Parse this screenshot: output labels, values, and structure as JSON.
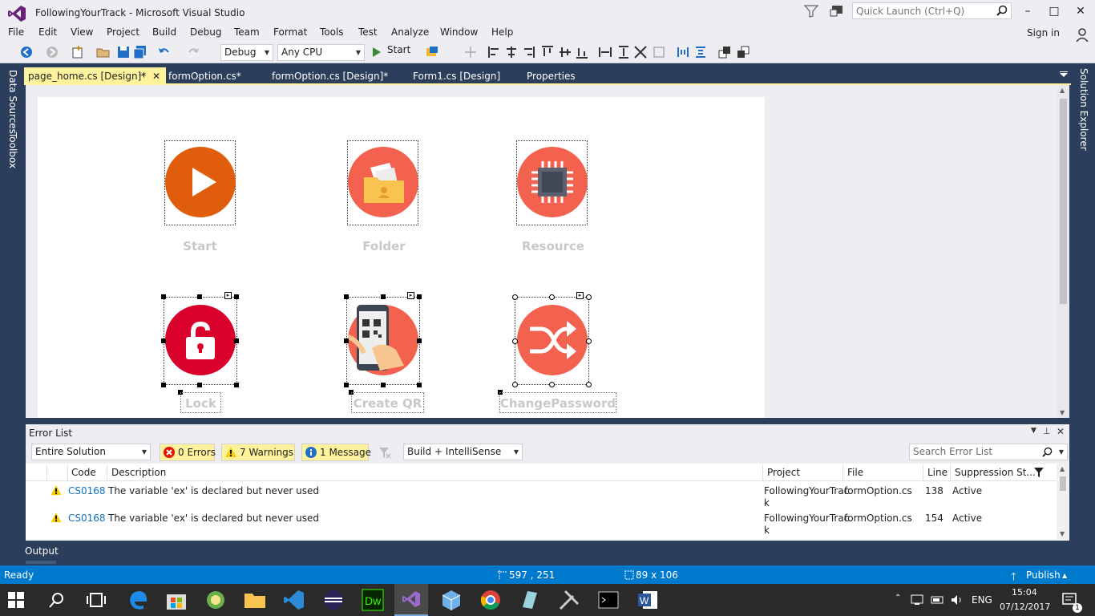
{
  "window": {
    "title": "FollowingYourTrack - Microsoft Visual Studio",
    "quick_launch_placeholder": "Quick Launch (Ctrl+Q)",
    "minimize": "–",
    "maximize": "□",
    "close": "✕"
  },
  "menu": {
    "items": [
      "File",
      "Edit",
      "View",
      "Project",
      "Build",
      "Debug",
      "Team",
      "Format",
      "Tools",
      "Test",
      "Analyze",
      "Window",
      "Help"
    ],
    "sign_in": "Sign in"
  },
  "toolbar": {
    "config": "Debug",
    "platform": "Any CPU",
    "start_label": "Start"
  },
  "side_tabs": {
    "left": [
      "Data Sources",
      "Toolbox"
    ],
    "right": "Solution Explorer"
  },
  "doc_tabs": [
    {
      "label": "page_home.cs [Design]*",
      "active": true
    },
    {
      "label": "formOption.cs*",
      "active": false
    },
    {
      "label": "formOption.cs [Design]*",
      "active": false
    },
    {
      "label": "Form1.cs [Design]",
      "active": false
    },
    {
      "label": "Properties",
      "active": false
    }
  ],
  "designer": {
    "buttons": [
      {
        "label": "Start",
        "color": "#e05e0b"
      },
      {
        "label": "Folder",
        "color": "#f2624f"
      },
      {
        "label": "Resource",
        "color": "#f2624f"
      },
      {
        "label": "Lock",
        "color": "#d9002c"
      },
      {
        "label": "Create QR",
        "color": "#f2624f"
      },
      {
        "label": "ChangePassword",
        "color": "#f2624f"
      }
    ]
  },
  "error_list": {
    "title": "Error List",
    "scope": "Entire Solution",
    "errors": "0 Errors",
    "warnings": "7 Warnings",
    "messages": "1 Message",
    "source": "Build + IntelliSense",
    "search_placeholder": "Search Error List",
    "columns": [
      "Code",
      "Description",
      "Project",
      "File",
      "Line",
      "Suppression St..."
    ],
    "rows": [
      {
        "code": "CS0168",
        "description": "The variable 'ex' is declared but never used",
        "project_line1": "FollowingYourTrac",
        "project_line2": "k",
        "file": "formOption.cs",
        "line": "138",
        "suppression": "Active"
      },
      {
        "code": "CS0168",
        "description": "The variable 'ex' is declared but never used",
        "project_line1": "FollowingYourTrac",
        "project_line2": "k",
        "file": "formOption.cs",
        "line": "154",
        "suppression": "Active"
      }
    ]
  },
  "output_tab": "Output",
  "status": {
    "ready": "Ready",
    "position": "597 , 251",
    "size": "89 x 106",
    "publish": "Publish"
  },
  "taskbar": {
    "lang": "ENG",
    "time": "15:04",
    "date": "07/12/2017",
    "notifications": "1"
  },
  "colors": {
    "accent": "#007acc",
    "frame": "#2b3f5c",
    "active_tab": "#fff29d"
  }
}
